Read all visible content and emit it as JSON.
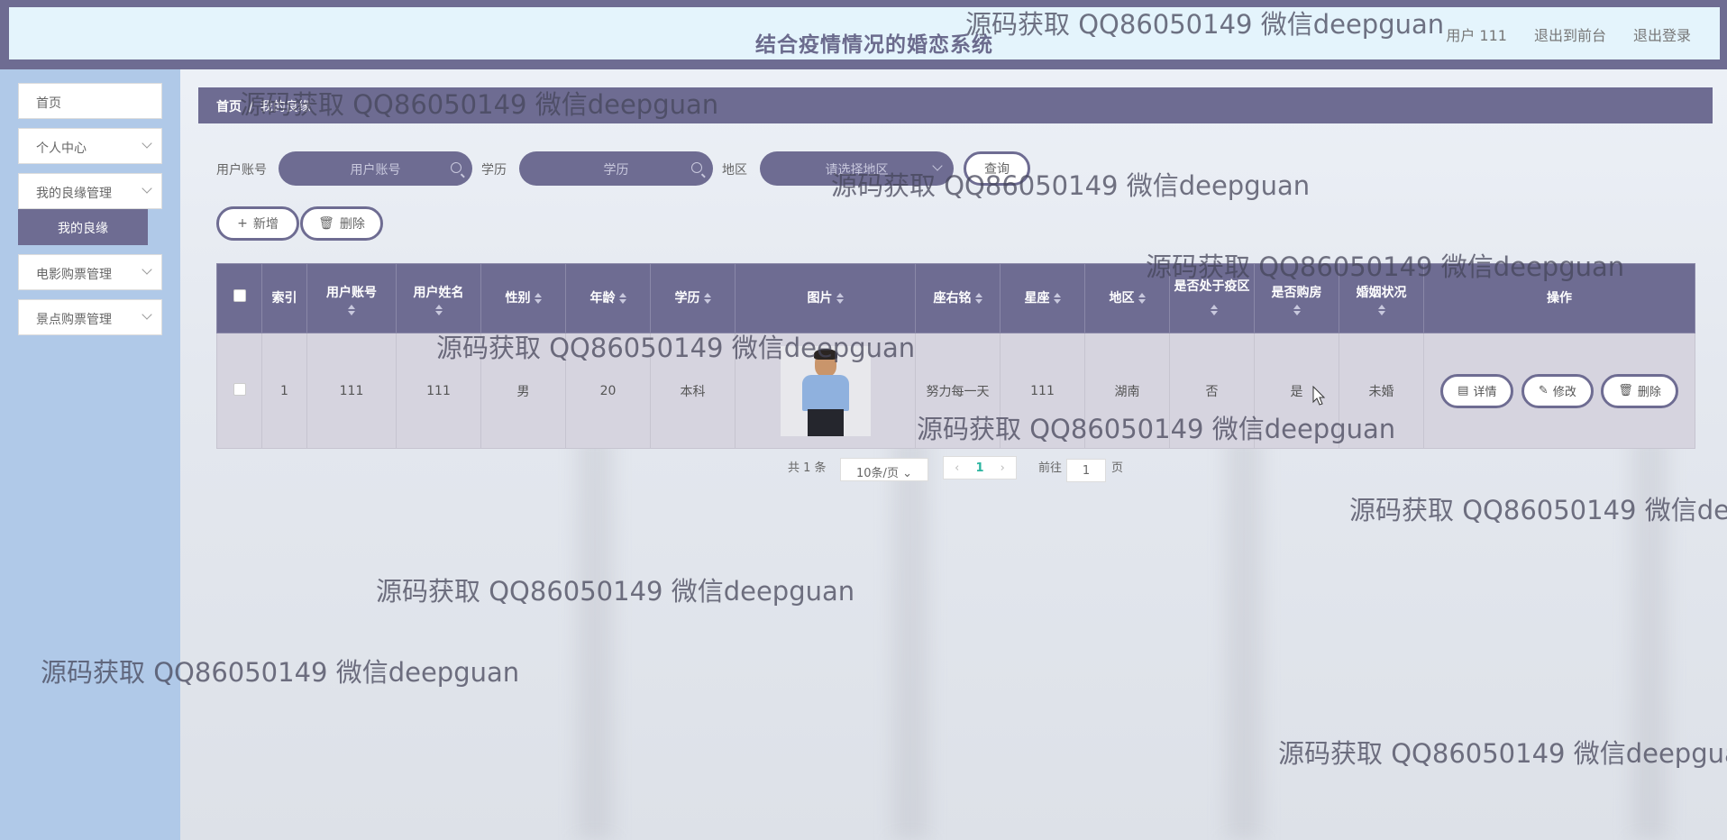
{
  "header": {
    "title": "结合疫情情况的婚恋系统",
    "user": "用户 111",
    "to_frontend": "退出到前台",
    "logout": "退出登录"
  },
  "sidebar": {
    "items": [
      {
        "label": "首页"
      },
      {
        "label": "个人中心"
      },
      {
        "label": "我的良缘管理"
      },
      {
        "label": "电影购票管理"
      },
      {
        "label": "景点购票管理"
      }
    ],
    "active_sub": "我的良缘"
  },
  "breadcrumb": {
    "home": "首页",
    "current": "我的良缘"
  },
  "filters": {
    "account_label": "用户账号",
    "account_placeholder": "用户账号",
    "edu_label": "学历",
    "edu_placeholder": "学历",
    "region_label": "地区",
    "region_placeholder": "请选择地区",
    "query_button": "查询"
  },
  "actions": {
    "add": "新增",
    "delete": "删除"
  },
  "table": {
    "headers": [
      "索引",
      "用户账号",
      "用户姓名",
      "性别",
      "年龄",
      "学历",
      "图片",
      "座右铭",
      "星座",
      "地区",
      "是否处于疫区",
      "是否购房",
      "婚姻状况",
      "操作"
    ],
    "row": {
      "index": "1",
      "account": "111",
      "name": "111",
      "gender": "男",
      "age": "20",
      "education": "本科",
      "motto": "努力每一天",
      "constellation": "111",
      "region": "湖南",
      "epidemic": "否",
      "house": "是",
      "marriage": "未婚"
    },
    "row_actions": {
      "detail": "详情",
      "edit": "修改",
      "delete": "删除"
    }
  },
  "pagination": {
    "total": "共 1 条",
    "page_size": "10条/页",
    "current_page": "1",
    "goto_label": "前往",
    "goto_value": "1",
    "page_suffix": "页"
  },
  "watermark": "源码获取 QQ86050149 微信deepguan",
  "colors": {
    "accent": "#6e6c92",
    "sidebar": "#b0c9e8",
    "header_bg": "#e4f4fc"
  }
}
